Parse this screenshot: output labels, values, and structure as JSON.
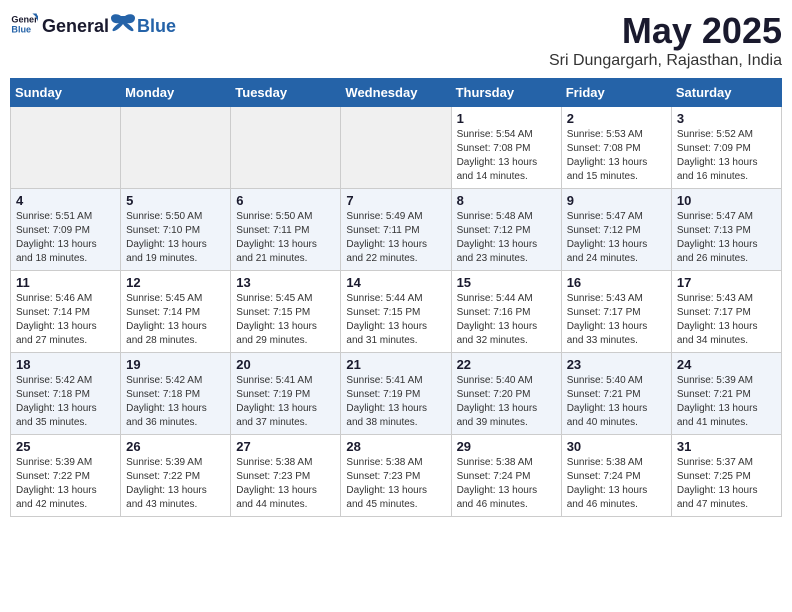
{
  "logo": {
    "text_general": "General",
    "text_blue": "Blue"
  },
  "title": "May 2025",
  "location": "Sri Dungargarh, Rajasthan, India",
  "weekdays": [
    "Sunday",
    "Monday",
    "Tuesday",
    "Wednesday",
    "Thursday",
    "Friday",
    "Saturday"
  ],
  "weeks": [
    [
      {
        "day": "",
        "info": ""
      },
      {
        "day": "",
        "info": ""
      },
      {
        "day": "",
        "info": ""
      },
      {
        "day": "",
        "info": ""
      },
      {
        "day": "1",
        "info": "Sunrise: 5:54 AM\nSunset: 7:08 PM\nDaylight: 13 hours\nand 14 minutes."
      },
      {
        "day": "2",
        "info": "Sunrise: 5:53 AM\nSunset: 7:08 PM\nDaylight: 13 hours\nand 15 minutes."
      },
      {
        "day": "3",
        "info": "Sunrise: 5:52 AM\nSunset: 7:09 PM\nDaylight: 13 hours\nand 16 minutes."
      }
    ],
    [
      {
        "day": "4",
        "info": "Sunrise: 5:51 AM\nSunset: 7:09 PM\nDaylight: 13 hours\nand 18 minutes."
      },
      {
        "day": "5",
        "info": "Sunrise: 5:50 AM\nSunset: 7:10 PM\nDaylight: 13 hours\nand 19 minutes."
      },
      {
        "day": "6",
        "info": "Sunrise: 5:50 AM\nSunset: 7:11 PM\nDaylight: 13 hours\nand 21 minutes."
      },
      {
        "day": "7",
        "info": "Sunrise: 5:49 AM\nSunset: 7:11 PM\nDaylight: 13 hours\nand 22 minutes."
      },
      {
        "day": "8",
        "info": "Sunrise: 5:48 AM\nSunset: 7:12 PM\nDaylight: 13 hours\nand 23 minutes."
      },
      {
        "day": "9",
        "info": "Sunrise: 5:47 AM\nSunset: 7:12 PM\nDaylight: 13 hours\nand 24 minutes."
      },
      {
        "day": "10",
        "info": "Sunrise: 5:47 AM\nSunset: 7:13 PM\nDaylight: 13 hours\nand 26 minutes."
      }
    ],
    [
      {
        "day": "11",
        "info": "Sunrise: 5:46 AM\nSunset: 7:14 PM\nDaylight: 13 hours\nand 27 minutes."
      },
      {
        "day": "12",
        "info": "Sunrise: 5:45 AM\nSunset: 7:14 PM\nDaylight: 13 hours\nand 28 minutes."
      },
      {
        "day": "13",
        "info": "Sunrise: 5:45 AM\nSunset: 7:15 PM\nDaylight: 13 hours\nand 29 minutes."
      },
      {
        "day": "14",
        "info": "Sunrise: 5:44 AM\nSunset: 7:15 PM\nDaylight: 13 hours\nand 31 minutes."
      },
      {
        "day": "15",
        "info": "Sunrise: 5:44 AM\nSunset: 7:16 PM\nDaylight: 13 hours\nand 32 minutes."
      },
      {
        "day": "16",
        "info": "Sunrise: 5:43 AM\nSunset: 7:17 PM\nDaylight: 13 hours\nand 33 minutes."
      },
      {
        "day": "17",
        "info": "Sunrise: 5:43 AM\nSunset: 7:17 PM\nDaylight: 13 hours\nand 34 minutes."
      }
    ],
    [
      {
        "day": "18",
        "info": "Sunrise: 5:42 AM\nSunset: 7:18 PM\nDaylight: 13 hours\nand 35 minutes."
      },
      {
        "day": "19",
        "info": "Sunrise: 5:42 AM\nSunset: 7:18 PM\nDaylight: 13 hours\nand 36 minutes."
      },
      {
        "day": "20",
        "info": "Sunrise: 5:41 AM\nSunset: 7:19 PM\nDaylight: 13 hours\nand 37 minutes."
      },
      {
        "day": "21",
        "info": "Sunrise: 5:41 AM\nSunset: 7:19 PM\nDaylight: 13 hours\nand 38 minutes."
      },
      {
        "day": "22",
        "info": "Sunrise: 5:40 AM\nSunset: 7:20 PM\nDaylight: 13 hours\nand 39 minutes."
      },
      {
        "day": "23",
        "info": "Sunrise: 5:40 AM\nSunset: 7:21 PM\nDaylight: 13 hours\nand 40 minutes."
      },
      {
        "day": "24",
        "info": "Sunrise: 5:39 AM\nSunset: 7:21 PM\nDaylight: 13 hours\nand 41 minutes."
      }
    ],
    [
      {
        "day": "25",
        "info": "Sunrise: 5:39 AM\nSunset: 7:22 PM\nDaylight: 13 hours\nand 42 minutes."
      },
      {
        "day": "26",
        "info": "Sunrise: 5:39 AM\nSunset: 7:22 PM\nDaylight: 13 hours\nand 43 minutes."
      },
      {
        "day": "27",
        "info": "Sunrise: 5:38 AM\nSunset: 7:23 PM\nDaylight: 13 hours\nand 44 minutes."
      },
      {
        "day": "28",
        "info": "Sunrise: 5:38 AM\nSunset: 7:23 PM\nDaylight: 13 hours\nand 45 minutes."
      },
      {
        "day": "29",
        "info": "Sunrise: 5:38 AM\nSunset: 7:24 PM\nDaylight: 13 hours\nand 46 minutes."
      },
      {
        "day": "30",
        "info": "Sunrise: 5:38 AM\nSunset: 7:24 PM\nDaylight: 13 hours\nand 46 minutes."
      },
      {
        "day": "31",
        "info": "Sunrise: 5:37 AM\nSunset: 7:25 PM\nDaylight: 13 hours\nand 47 minutes."
      }
    ]
  ]
}
